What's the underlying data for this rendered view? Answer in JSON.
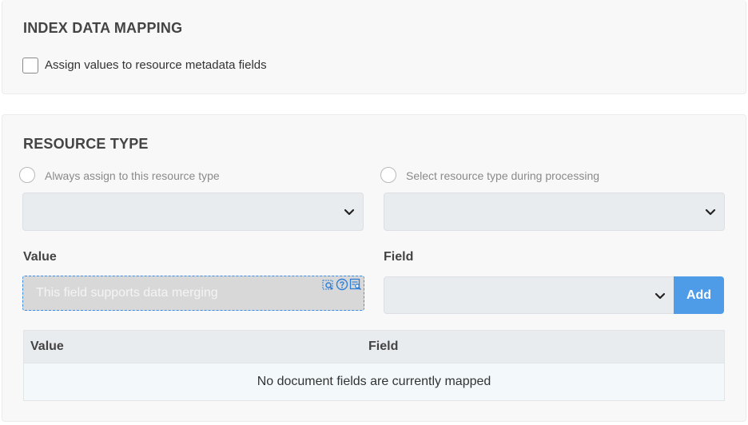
{
  "index_mapping": {
    "title": "INDEX DATA MAPPING",
    "assign_checkbox_label": "Assign values to resource metadata fields",
    "assign_checked": false
  },
  "resource_type": {
    "title": "RESOURCE TYPE",
    "radio_always_label": "Always assign to this resource type",
    "radio_select_label": "Select resource type during processing",
    "always_select_value": "",
    "during_select_value": ""
  },
  "mapping_form": {
    "value_label": "Value",
    "field_label": "Field",
    "value_placeholder": "This field supports data merging",
    "merge_icons": [
      "search-icon",
      "help-icon",
      "merge-field-icon"
    ],
    "field_select_value": "",
    "add_button_label": "Add"
  },
  "mapping_table": {
    "columns": [
      "Value",
      "Field"
    ],
    "empty_message": "No document fields are currently mapped"
  },
  "colors": {
    "accent": "#4e9be8",
    "card_background": "#f8f8f8",
    "select_background": "#e9ecef"
  }
}
